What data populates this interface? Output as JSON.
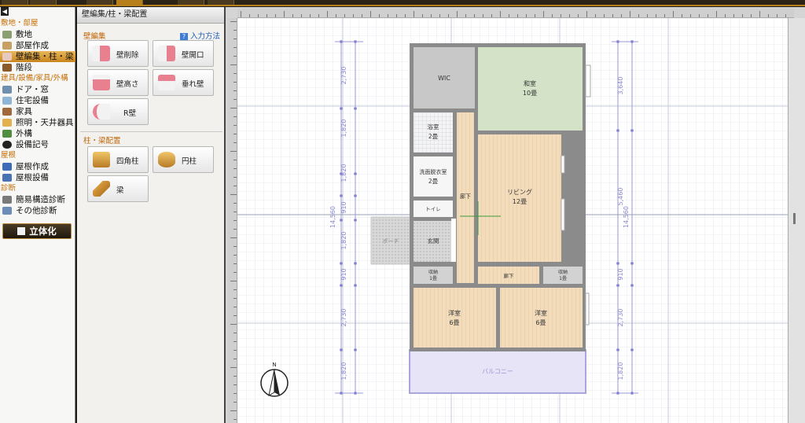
{
  "left_menu": {
    "sections": {
      "site_rooms": "敷地・部屋",
      "fixtures": "建具/設備/家具/外構",
      "roof": "屋根",
      "diagnosis": "診断"
    },
    "items": [
      {
        "label": "敷地",
        "icon": "site-icon"
      },
      {
        "label": "部屋作成",
        "icon": "room-icon"
      },
      {
        "label": "壁編集・柱・梁",
        "icon": "wall-icon",
        "active": true
      },
      {
        "label": "階段",
        "icon": "stairs-icon"
      },
      {
        "label": "ドア・窓",
        "icon": "door-icon"
      },
      {
        "label": "住宅設備",
        "icon": "equipment-icon"
      },
      {
        "label": "家具",
        "icon": "furniture-icon"
      },
      {
        "label": "照明・天井器具",
        "icon": "lighting-icon"
      },
      {
        "label": "外構",
        "icon": "exterior-icon"
      },
      {
        "label": "設備記号",
        "icon": "symbol-icon"
      },
      {
        "label": "屋根作成",
        "icon": "roof-icon"
      },
      {
        "label": "屋根設備",
        "icon": "roof-equipment-icon"
      },
      {
        "label": "簡易構造診断",
        "icon": "structure-icon"
      },
      {
        "label": "その他診断",
        "icon": "diagnosis-icon"
      }
    ],
    "solid_button": "立体化"
  },
  "tool_panel": {
    "title": "壁編集/柱・梁配置",
    "wall_group": "壁編集",
    "help": "入力方法",
    "wall_tools": [
      "壁削除",
      "壁開口",
      "壁高さ",
      "垂れ壁",
      "R壁"
    ],
    "column_group": "柱・梁配置",
    "column_tools": [
      "四角柱",
      "円柱",
      "梁"
    ]
  },
  "floor_plan": {
    "rooms": {
      "wic": "WIC",
      "washitsu": "和室",
      "washitsu_size": "10畳",
      "bath": "浴室",
      "bath_size": "2畳",
      "dressing": "洗面脱衣室",
      "dressing_size": "2畳",
      "toilet": "トイレ",
      "hall_v": "廊下",
      "living": "リビング",
      "living_size": "12畳",
      "entrance": "玄関",
      "porch": "ポーチ",
      "storage_l": "収納",
      "storage_l_size": "1畳",
      "hall_h": "廊下",
      "storage_r": "収納",
      "storage_r_size": "1畳",
      "youshitsu1": "洋室",
      "youshitsu1_size": "6畳",
      "youshitsu2": "洋室",
      "youshitsu2_size": "6畳",
      "balcony": "バルコニー"
    },
    "dims_left": [
      "2,730",
      "1,820",
      "1,820",
      "910",
      "1,820",
      "910",
      "2,730",
      "1,820"
    ],
    "dims_right": [
      "3,640",
      "5,460",
      "910",
      "2,730",
      "1,820"
    ],
    "total_left": "14,560",
    "total_right": "14,560",
    "compass": "N"
  }
}
